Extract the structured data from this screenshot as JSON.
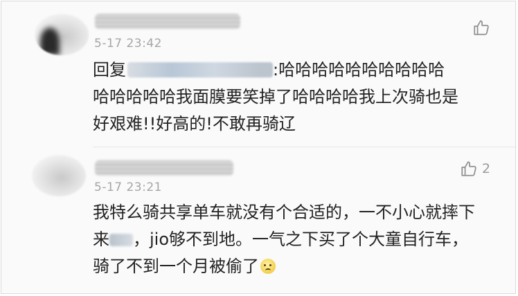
{
  "comments": [
    {
      "timestamp": "5-17 23:42",
      "like_count": "",
      "reply_prefix": "回复",
      "reply_colon": ":",
      "lines": [
        "哈哈哈哈哈哈哈哈哈哈",
        "哈哈哈哈哈我面膜要笑掉了哈哈哈哈我上次骑也是",
        "好艰难!!好高的!不敢再骑辽"
      ]
    },
    {
      "timestamp": "5-17 23:21",
      "like_count": "2",
      "lines": [
        "我特么骑共享单车就没有个合适的，一不小心就摔下",
        "来",
        "，jio够不到地。一气之下买了个大童自行车，",
        "骑了不到一个月被偷了"
      ]
    }
  ],
  "icons": {
    "like": "thumbs-up-icon",
    "emoji": "worried-face-emoji"
  }
}
